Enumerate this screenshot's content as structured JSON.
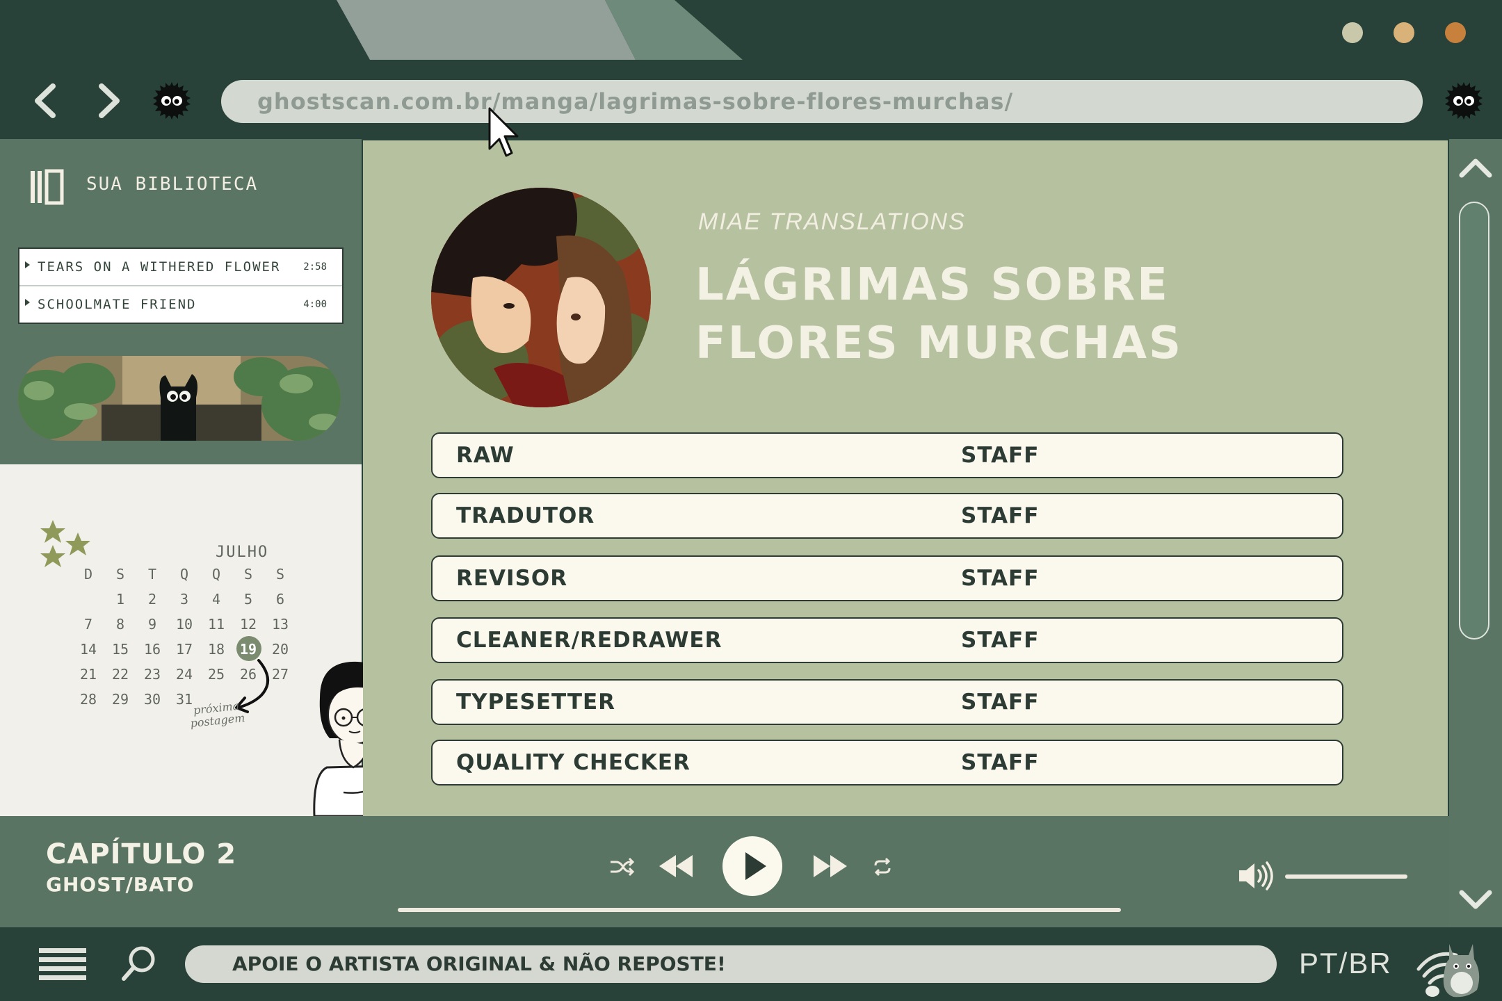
{
  "browser": {
    "url": "ghostscan.com.br/manga/lagrimas-sobre-flores-murchas/",
    "window_dots": [
      "#c9c8aa",
      "#d9b27a",
      "#c7813d"
    ],
    "back_icon": "chevron-left-icon",
    "forward_icon": "chevron-right-icon"
  },
  "sidebar": {
    "library_title": "SUA BIBLIOTECA",
    "tracks": [
      {
        "name": "TEARS ON A WITHERED FLOWER",
        "time": "2:58"
      },
      {
        "name": "SCHOOLMATE FRIEND",
        "time": "4:00"
      }
    ],
    "calendar": {
      "month": "JULHO",
      "weekdays": [
        "D",
        "S",
        "T",
        "Q",
        "Q",
        "S",
        "S"
      ],
      "rows": [
        [
          "",
          "1",
          "2",
          "3",
          "4",
          "5",
          "6"
        ],
        [
          "7",
          "8",
          "9",
          "10",
          "11",
          "12",
          "13"
        ],
        [
          "14",
          "15",
          "16",
          "17",
          "18",
          "19",
          "20"
        ],
        [
          "21",
          "22",
          "23",
          "24",
          "25",
          "26",
          "27"
        ],
        [
          "28",
          "29",
          "30",
          "31",
          "",
          "",
          ""
        ]
      ],
      "highlighted_day": "19",
      "note": "próxima postagem"
    }
  },
  "main": {
    "scan_group": "MIAE TRANSLATIONS",
    "title_line1": "LÁGRIMAS SOBRE",
    "title_line2": "FLORES MURCHAS",
    "credits": [
      {
        "role": "RAW",
        "value": "STAFF"
      },
      {
        "role": "TRADUTOR",
        "value": "STAFF"
      },
      {
        "role": "REVISOR",
        "value": "STAFF"
      },
      {
        "role": "CLEANER/REDRAWER",
        "value": "STAFF"
      },
      {
        "role": "TYPESETTER",
        "value": "STAFF"
      },
      {
        "role": "QUALITY CHECKER",
        "value": "STAFF"
      }
    ]
  },
  "player": {
    "chapter": "CAPÍTULO 2",
    "source": "GHOST/BATO"
  },
  "footer": {
    "notice": "APOIE O ARTISTA ORIGINAL & NÃO REPOSTE!",
    "language": "PT/BR"
  },
  "colors": {
    "dark_green": "#28423a",
    "mid_green": "#5b7565",
    "sage": "#b6c29f",
    "cream": "#fbf8ee"
  }
}
